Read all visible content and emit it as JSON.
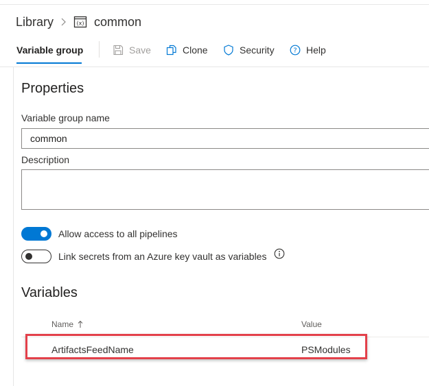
{
  "breadcrumb": {
    "library": "Library",
    "current": "common"
  },
  "toolbar": {
    "tab_label": "Variable group",
    "save_label": "Save",
    "clone_label": "Clone",
    "security_label": "Security",
    "help_label": "Help"
  },
  "properties": {
    "heading": "Properties",
    "name_label": "Variable group name",
    "name_value": "common",
    "description_label": "Description",
    "description_value": ""
  },
  "toggles": {
    "allow_access": {
      "label": "Allow access to all pipelines",
      "on": true
    },
    "link_secrets": {
      "label": "Link secrets from an Azure key vault as variables",
      "on": false
    }
  },
  "variables": {
    "heading": "Variables",
    "columns": {
      "name": "Name",
      "value": "Value"
    },
    "sort": "ascending",
    "rows": [
      {
        "name": "ArtifactsFeedName",
        "value": "PSModules"
      }
    ]
  },
  "colors": {
    "accent": "#0078d4",
    "highlight": "#e3404a"
  },
  "icons": {
    "breadcrumb_separator": "chevron-right-icon",
    "group": "variable-group-icon",
    "save": "save-icon",
    "clone": "clone-icon",
    "security": "shield-icon",
    "help": "help-circle-icon",
    "info": "info-icon",
    "sort": "arrow-up-icon"
  }
}
